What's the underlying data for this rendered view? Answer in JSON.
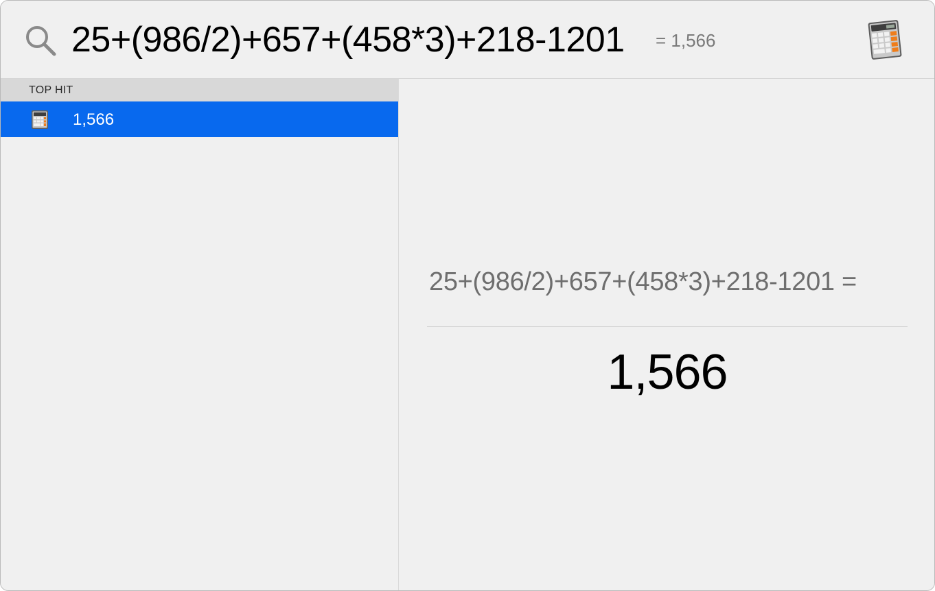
{
  "search": {
    "query": "25+(986/2)+657+(458*3)+218-1201",
    "inline_result": "= 1,566",
    "icon": "search-icon",
    "app_icon": "calculator-icon"
  },
  "results": {
    "section_label": "TOP HIT",
    "items": [
      {
        "label": "1,566",
        "icon": "calculator-icon",
        "selected": true
      }
    ]
  },
  "preview": {
    "expression": "25+(986/2)+657+(458*3)+218-1201 =",
    "result": "1,566"
  },
  "colors": {
    "selection": "#0869ee",
    "background": "#f0f0f0",
    "section_header": "#d8d8d8"
  }
}
